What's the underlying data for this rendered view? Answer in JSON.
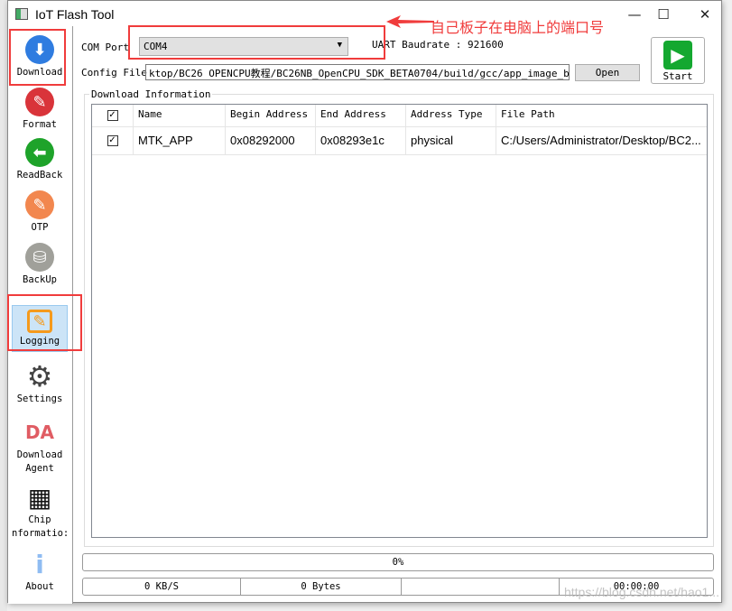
{
  "window": {
    "title": "IoT Flash Tool",
    "minimize": "—",
    "maximize": "☐",
    "close": "✕"
  },
  "sidebar": {
    "items": [
      {
        "label": "Download",
        "icon": "download-icon",
        "color": "#2f7ce0"
      },
      {
        "label": "Format",
        "icon": "format-icon",
        "color": "#d9343a"
      },
      {
        "label": "ReadBack",
        "icon": "readback-icon",
        "color": "#1ea32a"
      },
      {
        "label": "OTP",
        "icon": "otp-icon",
        "color": "#f2874f"
      },
      {
        "label": "BackUp",
        "icon": "backup-icon",
        "color": "#a0a09a"
      },
      {
        "label": "Logging",
        "icon": "logging-icon",
        "color": "#f59a1c",
        "selected": true
      },
      {
        "label": "Settings",
        "icon": "gear-icon",
        "color": "#444444"
      },
      {
        "label": "Download",
        "label2": "Agent",
        "icon": "da-icon",
        "glyph": "DA",
        "color": "#e05c63"
      },
      {
        "label": "Chip",
        "label2": "nformatio:",
        "icon": "chip-icon",
        "color": "#111111"
      },
      {
        "label": "About",
        "icon": "info-icon",
        "color": "#8fbcf2"
      }
    ]
  },
  "com_port": {
    "label": "COM Port",
    "value": "COM4"
  },
  "uart": {
    "label": "UART Baudrate : 921600"
  },
  "config_file": {
    "label": "Config File",
    "value": "ktop/BC26 OPENCPU教程/BC26NB_OpenCPU_SDK_BETA0704/build/gcc/app_image_bin.cfg",
    "open_label": "Open"
  },
  "start": {
    "label": "Start"
  },
  "download_info": {
    "title": "Download Information",
    "columns": [
      "Name",
      "Begin Address",
      "End Address",
      "Address Type",
      "File Path"
    ],
    "rows": [
      {
        "checked": true,
        "name": "MTK_APP",
        "begin": "0x08292000",
        "end": "0x08293e1c",
        "type": "physical",
        "path": "C:/Users/Administrator/Desktop/BC2..."
      }
    ]
  },
  "progress": {
    "value": 0,
    "label": "0%"
  },
  "status": {
    "speed": "0 KB/S",
    "bytes": "0 Bytes",
    "blank": "",
    "time": "00:00:00"
  },
  "annotation": {
    "text": "自己板子在电脑上的端口号",
    "color": "#f03c3c"
  },
  "watermark": "https://blog.csdn.net/hao1..."
}
